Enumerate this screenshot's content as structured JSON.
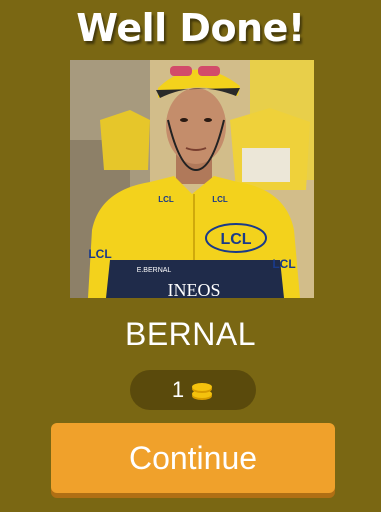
{
  "header": {
    "title": "Well Done!"
  },
  "photo": {
    "subject": "cyclist-in-yellow-jersey",
    "jersey_texts": [
      "LCL",
      "LCL",
      "LCL",
      "LCL",
      "E.BERNAL",
      "INEOS"
    ]
  },
  "answer": {
    "text": "BERNAL"
  },
  "coins": {
    "count": "1",
    "icon": "coin-stack-icon",
    "color": "#f4c20d"
  },
  "actions": {
    "continue_label": "Continue"
  },
  "colors": {
    "background": "#7a6713",
    "pill": "#5a4a0c",
    "button": "#f0a12b",
    "button_shadow": "#b06f14",
    "jersey": "#f3d21c"
  }
}
